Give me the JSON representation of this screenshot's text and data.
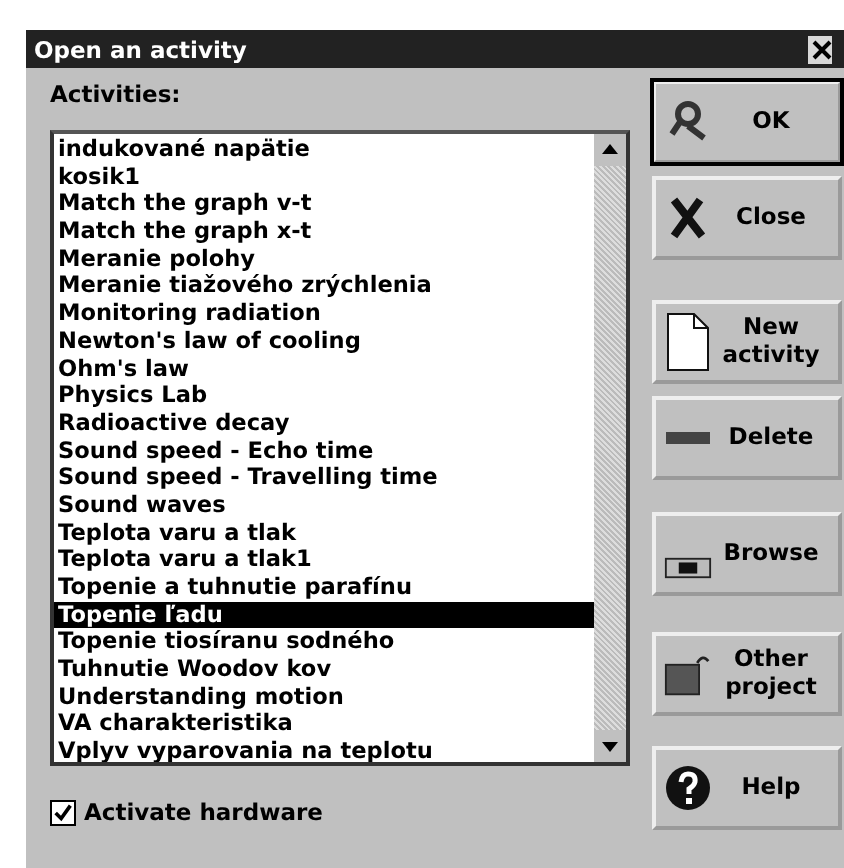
{
  "window": {
    "title": "Open an activity"
  },
  "activities": {
    "label": "Activities:",
    "items": [
      {
        "text": "indukované napätie",
        "selected": false
      },
      {
        "text": "kosik1",
        "selected": false
      },
      {
        "text": "Match the graph v-t",
        "selected": false
      },
      {
        "text": "Match the graph x-t",
        "selected": false
      },
      {
        "text": "Meranie polohy",
        "selected": false
      },
      {
        "text": "Meranie tiažového zrýchlenia",
        "selected": false
      },
      {
        "text": "Monitoring radiation",
        "selected": false
      },
      {
        "text": "Newton's law of cooling",
        "selected": false
      },
      {
        "text": "Ohm's law",
        "selected": false
      },
      {
        "text": "Physics Lab",
        "selected": false
      },
      {
        "text": "Radioactive decay",
        "selected": false
      },
      {
        "text": "Sound speed - Echo time",
        "selected": false
      },
      {
        "text": "Sound speed - Travelling time",
        "selected": false
      },
      {
        "text": "Sound waves",
        "selected": false
      },
      {
        "text": "Teplota varu a tlak",
        "selected": false
      },
      {
        "text": "Teplota varu a tlak1",
        "selected": false
      },
      {
        "text": "Topenie a tuhnutie parafínu",
        "selected": false
      },
      {
        "text": "Topenie ľadu",
        "selected": true
      },
      {
        "text": "Topenie tiosíranu sodného",
        "selected": false
      },
      {
        "text": "Tuhnutie Woodov kov",
        "selected": false
      },
      {
        "text": "Understanding motion",
        "selected": false
      },
      {
        "text": "VA charakteristika",
        "selected": false
      },
      {
        "text": "Vplyv vyparovania na teplotu",
        "selected": false
      }
    ]
  },
  "activate_hardware": {
    "label": "Activate hardware",
    "checked": true
  },
  "buttons": [
    {
      "kind": "ok",
      "label": "OK",
      "default": true
    },
    {
      "kind": "close",
      "label": "Close",
      "default": false
    },
    {
      "kind": "new",
      "label": "New activity",
      "default": false
    },
    {
      "kind": "delete",
      "label": "Delete",
      "default": false
    },
    {
      "kind": "browse",
      "label": "Browse",
      "default": false
    },
    {
      "kind": "project",
      "label": "Other project",
      "default": false
    },
    {
      "kind": "help",
      "label": "Help",
      "default": false
    }
  ]
}
